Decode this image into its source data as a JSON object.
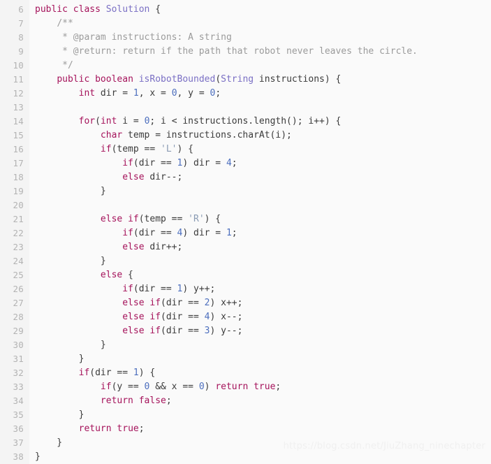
{
  "editor": {
    "language": "java",
    "first_line_number": 6,
    "last_line_number": 38,
    "background_color": "#fafafa",
    "gutter_color": "#f4f4f4",
    "line_number_color": "#b3b3b3",
    "colors": {
      "keyword": "#a5135b",
      "type": "#7a6fc4",
      "name": "#7a6fc4",
      "number": "#4d6fbe",
      "string": "#8a9bb4",
      "comment": "#9b9b9b",
      "plain": "#3b3b3b"
    }
  },
  "watermark": {
    "text": "https://blog.csdn.net/JiuZhang_ninechapter"
  },
  "lines": [
    {
      "no": "6",
      "tokens": [
        {
          "t": "kw",
          "v": "public"
        },
        {
          "t": "plain",
          "v": " "
        },
        {
          "t": "kw",
          "v": "class"
        },
        {
          "t": "plain",
          "v": " "
        },
        {
          "t": "name",
          "v": "Solution"
        },
        {
          "t": "plain",
          "v": " {"
        }
      ]
    },
    {
      "no": "7",
      "tokens": [
        {
          "t": "plain",
          "v": "    "
        },
        {
          "t": "cmt",
          "v": "/**"
        }
      ]
    },
    {
      "no": "8",
      "tokens": [
        {
          "t": "plain",
          "v": "     "
        },
        {
          "t": "cmt",
          "v": "* @param instructions: A string"
        }
      ]
    },
    {
      "no": "9",
      "tokens": [
        {
          "t": "plain",
          "v": "     "
        },
        {
          "t": "cmt",
          "v": "* @return: return if the path that robot never leaves the circle."
        }
      ]
    },
    {
      "no": "10",
      "tokens": [
        {
          "t": "plain",
          "v": "     "
        },
        {
          "t": "cmt",
          "v": "*/"
        }
      ]
    },
    {
      "no": "11",
      "tokens": [
        {
          "t": "plain",
          "v": "    "
        },
        {
          "t": "kw",
          "v": "public"
        },
        {
          "t": "plain",
          "v": " "
        },
        {
          "t": "kw",
          "v": "boolean"
        },
        {
          "t": "plain",
          "v": " "
        },
        {
          "t": "name",
          "v": "isRobotBounded"
        },
        {
          "t": "plain",
          "v": "("
        },
        {
          "t": "type",
          "v": "String"
        },
        {
          "t": "plain",
          "v": " instructions) {"
        }
      ]
    },
    {
      "no": "12",
      "tokens": [
        {
          "t": "plain",
          "v": "        "
        },
        {
          "t": "kw",
          "v": "int"
        },
        {
          "t": "plain",
          "v": " dir = "
        },
        {
          "t": "num",
          "v": "1"
        },
        {
          "t": "plain",
          "v": ", x = "
        },
        {
          "t": "num",
          "v": "0"
        },
        {
          "t": "plain",
          "v": ", y = "
        },
        {
          "t": "num",
          "v": "0"
        },
        {
          "t": "plain",
          "v": ";"
        }
      ]
    },
    {
      "no": "13",
      "tokens": [
        {
          "t": "plain",
          "v": ""
        }
      ]
    },
    {
      "no": "14",
      "tokens": [
        {
          "t": "plain",
          "v": "        "
        },
        {
          "t": "kw",
          "v": "for"
        },
        {
          "t": "plain",
          "v": "("
        },
        {
          "t": "kw",
          "v": "int"
        },
        {
          "t": "plain",
          "v": " i = "
        },
        {
          "t": "num",
          "v": "0"
        },
        {
          "t": "plain",
          "v": "; i < instructions.length(); i++) {"
        }
      ]
    },
    {
      "no": "15",
      "tokens": [
        {
          "t": "plain",
          "v": "            "
        },
        {
          "t": "kw",
          "v": "char"
        },
        {
          "t": "plain",
          "v": " temp = instructions.charAt(i);"
        }
      ]
    },
    {
      "no": "16",
      "tokens": [
        {
          "t": "plain",
          "v": "            "
        },
        {
          "t": "kw",
          "v": "if"
        },
        {
          "t": "plain",
          "v": "(temp == "
        },
        {
          "t": "str",
          "v": "'L'"
        },
        {
          "t": "plain",
          "v": ") {"
        }
      ]
    },
    {
      "no": "17",
      "tokens": [
        {
          "t": "plain",
          "v": "                "
        },
        {
          "t": "kw",
          "v": "if"
        },
        {
          "t": "plain",
          "v": "(dir == "
        },
        {
          "t": "num",
          "v": "1"
        },
        {
          "t": "plain",
          "v": ") dir = "
        },
        {
          "t": "num",
          "v": "4"
        },
        {
          "t": "plain",
          "v": ";"
        }
      ]
    },
    {
      "no": "18",
      "tokens": [
        {
          "t": "plain",
          "v": "                "
        },
        {
          "t": "kw",
          "v": "else"
        },
        {
          "t": "plain",
          "v": " dir--;"
        }
      ]
    },
    {
      "no": "19",
      "tokens": [
        {
          "t": "plain",
          "v": "            }"
        }
      ]
    },
    {
      "no": "20",
      "tokens": [
        {
          "t": "plain",
          "v": ""
        }
      ]
    },
    {
      "no": "21",
      "tokens": [
        {
          "t": "plain",
          "v": "            "
        },
        {
          "t": "kw",
          "v": "else"
        },
        {
          "t": "plain",
          "v": " "
        },
        {
          "t": "kw",
          "v": "if"
        },
        {
          "t": "plain",
          "v": "(temp == "
        },
        {
          "t": "str",
          "v": "'R'"
        },
        {
          "t": "plain",
          "v": ") {"
        }
      ]
    },
    {
      "no": "22",
      "tokens": [
        {
          "t": "plain",
          "v": "                "
        },
        {
          "t": "kw",
          "v": "if"
        },
        {
          "t": "plain",
          "v": "(dir == "
        },
        {
          "t": "num",
          "v": "4"
        },
        {
          "t": "plain",
          "v": ") dir = "
        },
        {
          "t": "num",
          "v": "1"
        },
        {
          "t": "plain",
          "v": ";"
        }
      ]
    },
    {
      "no": "23",
      "tokens": [
        {
          "t": "plain",
          "v": "                "
        },
        {
          "t": "kw",
          "v": "else"
        },
        {
          "t": "plain",
          "v": " dir++;"
        }
      ]
    },
    {
      "no": "24",
      "tokens": [
        {
          "t": "plain",
          "v": "            }"
        }
      ]
    },
    {
      "no": "25",
      "tokens": [
        {
          "t": "plain",
          "v": "            "
        },
        {
          "t": "kw",
          "v": "else"
        },
        {
          "t": "plain",
          "v": " {"
        }
      ]
    },
    {
      "no": "26",
      "tokens": [
        {
          "t": "plain",
          "v": "                "
        },
        {
          "t": "kw",
          "v": "if"
        },
        {
          "t": "plain",
          "v": "(dir == "
        },
        {
          "t": "num",
          "v": "1"
        },
        {
          "t": "plain",
          "v": ") y++;"
        }
      ]
    },
    {
      "no": "27",
      "tokens": [
        {
          "t": "plain",
          "v": "                "
        },
        {
          "t": "kw",
          "v": "else"
        },
        {
          "t": "plain",
          "v": " "
        },
        {
          "t": "kw",
          "v": "if"
        },
        {
          "t": "plain",
          "v": "(dir == "
        },
        {
          "t": "num",
          "v": "2"
        },
        {
          "t": "plain",
          "v": ") x++;"
        }
      ]
    },
    {
      "no": "28",
      "tokens": [
        {
          "t": "plain",
          "v": "                "
        },
        {
          "t": "kw",
          "v": "else"
        },
        {
          "t": "plain",
          "v": " "
        },
        {
          "t": "kw",
          "v": "if"
        },
        {
          "t": "plain",
          "v": "(dir == "
        },
        {
          "t": "num",
          "v": "4"
        },
        {
          "t": "plain",
          "v": ") x--;"
        }
      ]
    },
    {
      "no": "29",
      "tokens": [
        {
          "t": "plain",
          "v": "                "
        },
        {
          "t": "kw",
          "v": "else"
        },
        {
          "t": "plain",
          "v": " "
        },
        {
          "t": "kw",
          "v": "if"
        },
        {
          "t": "plain",
          "v": "(dir == "
        },
        {
          "t": "num",
          "v": "3"
        },
        {
          "t": "plain",
          "v": ") y--;"
        }
      ]
    },
    {
      "no": "30",
      "tokens": [
        {
          "t": "plain",
          "v": "            }"
        }
      ]
    },
    {
      "no": "31",
      "tokens": [
        {
          "t": "plain",
          "v": "        }"
        }
      ]
    },
    {
      "no": "32",
      "tokens": [
        {
          "t": "plain",
          "v": "        "
        },
        {
          "t": "kw",
          "v": "if"
        },
        {
          "t": "plain",
          "v": "(dir == "
        },
        {
          "t": "num",
          "v": "1"
        },
        {
          "t": "plain",
          "v": ") {"
        }
      ]
    },
    {
      "no": "33",
      "tokens": [
        {
          "t": "plain",
          "v": "            "
        },
        {
          "t": "kw",
          "v": "if"
        },
        {
          "t": "plain",
          "v": "(y == "
        },
        {
          "t": "num",
          "v": "0"
        },
        {
          "t": "plain",
          "v": " && x == "
        },
        {
          "t": "num",
          "v": "0"
        },
        {
          "t": "plain",
          "v": ") "
        },
        {
          "t": "kw",
          "v": "return"
        },
        {
          "t": "plain",
          "v": " "
        },
        {
          "t": "kw",
          "v": "true"
        },
        {
          "t": "plain",
          "v": ";"
        }
      ]
    },
    {
      "no": "34",
      "tokens": [
        {
          "t": "plain",
          "v": "            "
        },
        {
          "t": "kw",
          "v": "return"
        },
        {
          "t": "plain",
          "v": " "
        },
        {
          "t": "kw",
          "v": "false"
        },
        {
          "t": "plain",
          "v": ";"
        }
      ]
    },
    {
      "no": "35",
      "tokens": [
        {
          "t": "plain",
          "v": "        }"
        }
      ]
    },
    {
      "no": "36",
      "tokens": [
        {
          "t": "plain",
          "v": "        "
        },
        {
          "t": "kw",
          "v": "return"
        },
        {
          "t": "plain",
          "v": " "
        },
        {
          "t": "kw",
          "v": "true"
        },
        {
          "t": "plain",
          "v": ";"
        }
      ]
    },
    {
      "no": "37",
      "tokens": [
        {
          "t": "plain",
          "v": "    }"
        }
      ]
    },
    {
      "no": "38",
      "tokens": [
        {
          "t": "plain",
          "v": "}"
        }
      ]
    }
  ]
}
